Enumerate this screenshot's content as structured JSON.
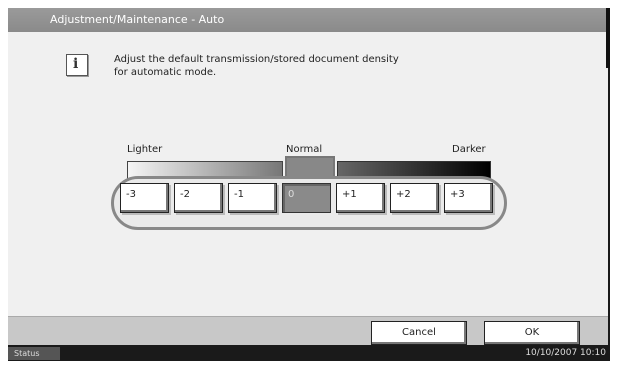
{
  "title": "Adjustment/Maintenance - Auto",
  "message": "Adjust the default transmission/stored document density\nfor automatic mode.",
  "scale": {
    "lighter": "Lighter",
    "normal": "Normal",
    "darker": "Darker"
  },
  "density_levels": [
    "-3",
    "-2",
    "-1",
    "0",
    "+1",
    "+2",
    "+3"
  ],
  "selected_level": "0",
  "buttons": {
    "cancel": "Cancel",
    "ok": "OK"
  },
  "statusbar": {
    "status_label": "Status",
    "datetime": "10/10/2007  10:10"
  },
  "icons": {
    "info": "info-icon"
  }
}
